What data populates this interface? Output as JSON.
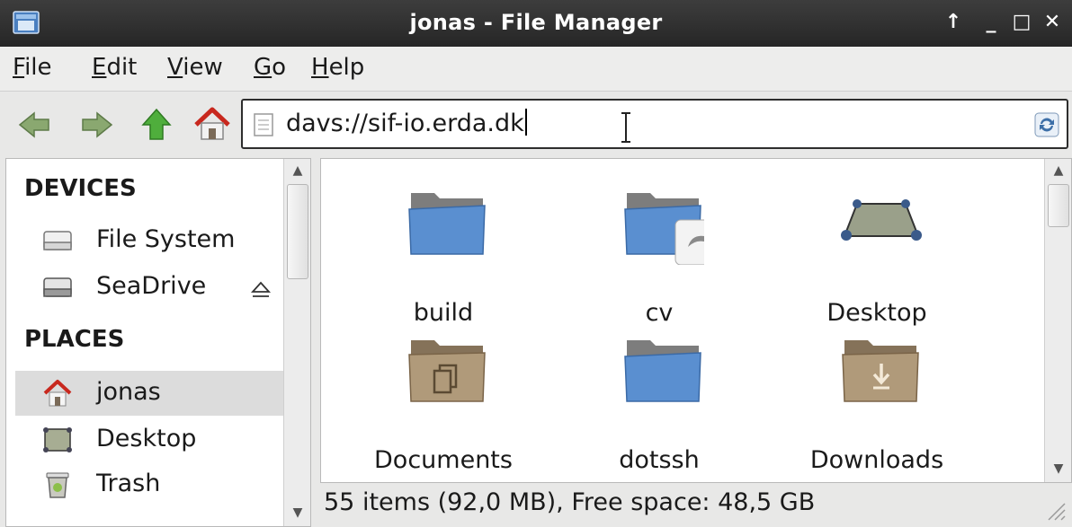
{
  "window": {
    "title": "jonas - File Manager",
    "controls": [
      "↑",
      "_",
      "□",
      "✕"
    ]
  },
  "menu": [
    {
      "mnemonic": "F",
      "rest": "ile"
    },
    {
      "mnemonic": "E",
      "rest": "dit"
    },
    {
      "mnemonic": "V",
      "rest": "iew"
    },
    {
      "mnemonic": "G",
      "rest": "o"
    },
    {
      "mnemonic": "H",
      "rest": "elp"
    }
  ],
  "toolbar": {
    "back_icon": "arrow-left-icon",
    "forward_icon": "arrow-right-icon",
    "up_icon": "arrow-up-icon",
    "home_icon": "home-icon"
  },
  "location": {
    "value": "davs://sif-io.erda.dk"
  },
  "sidebar": {
    "devices_header": "DEVICES",
    "places_header": "PLACES",
    "devices": [
      {
        "label": "File System"
      },
      {
        "label": "SeaDrive"
      }
    ],
    "places": [
      {
        "label": "jonas",
        "selected": true
      },
      {
        "label": "Desktop"
      },
      {
        "label": "Trash"
      }
    ]
  },
  "files": [
    {
      "name": "build",
      "icon": "folder-icon"
    },
    {
      "name": "cv",
      "icon": "folder-link-icon"
    },
    {
      "name": "Desktop",
      "icon": "desktop-icon"
    },
    {
      "name": "Documents",
      "icon": "documents-folder-icon"
    },
    {
      "name": "dotssh",
      "icon": "folder-icon"
    },
    {
      "name": "Downloads",
      "icon": "downloads-folder-icon"
    }
  ],
  "status": {
    "text": "55 items (92,0 MB), Free space: 48,5 GB"
  },
  "colors": {
    "titlebar": "#2f2f2f",
    "folder_blue": "#5a8fd0",
    "folder_brown": "#a08a6c",
    "selection": "#dcdcdc"
  }
}
